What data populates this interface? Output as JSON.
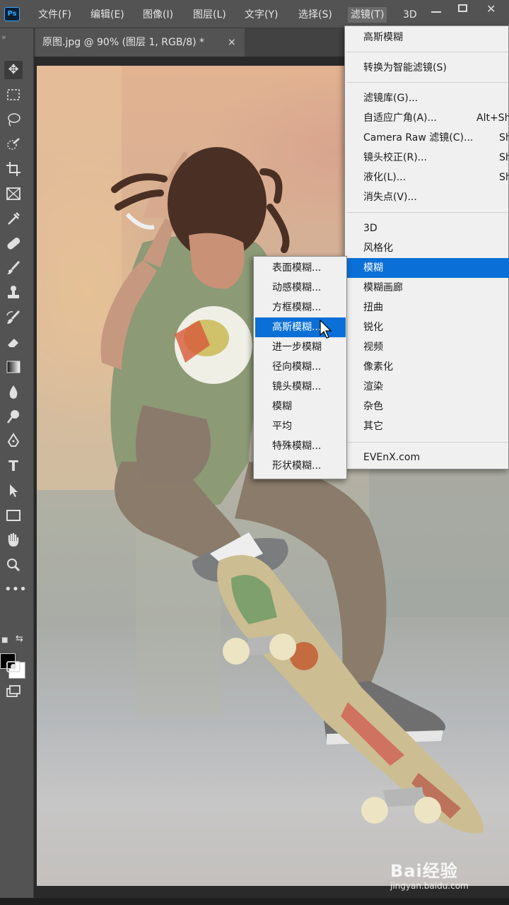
{
  "app": {
    "logo": "Ps"
  },
  "menubar": {
    "items": [
      "文件(F)",
      "编辑(E)",
      "图像(I)",
      "图层(L)",
      "文字(Y)",
      "选择(S)",
      "滤镜(T)",
      "3D"
    ],
    "active": "滤镜(T)"
  },
  "document": {
    "tab_title": "原图.jpg @ 90% (图层 1, RGB/8) *",
    "close_glyph": "×"
  },
  "toolbar": {
    "tools": [
      "move-tool",
      "marquee-tool",
      "lasso-tool",
      "quick-select-tool",
      "crop-tool",
      "frame-tool",
      "eyedropper-tool",
      "healing-brush-tool",
      "brush-tool",
      "clone-stamp-tool",
      "history-brush-tool",
      "eraser-tool",
      "gradient-tool",
      "blur-tool",
      "dodge-tool",
      "pen-tool",
      "type-tool",
      "path-select-tool",
      "rectangle-tool",
      "hand-tool",
      "zoom-tool",
      "more-tools"
    ],
    "foreground_color": "#000000",
    "background_color": "#ffffff"
  },
  "filter_menu": {
    "last_filter": "高斯模糊",
    "convert_smart": "转换为智能滤镜(S)",
    "group1": [
      {
        "label": "滤镜库(G)...",
        "shortcut": ""
      },
      {
        "label": "自适应广角(A)...",
        "shortcut": "Alt+Sh"
      },
      {
        "label": "Camera Raw 滤镜(C)...",
        "shortcut": "Sh"
      },
      {
        "label": "镜头校正(R)...",
        "shortcut": "Sh"
      },
      {
        "label": "液化(L)...",
        "shortcut": "Sh"
      },
      {
        "label": "消失点(V)...",
        "shortcut": ""
      }
    ],
    "group2": [
      "3D",
      "风格化",
      "模糊",
      "模糊画廊",
      "扭曲",
      "锐化",
      "视频",
      "像素化",
      "渲染",
      "杂色",
      "其它"
    ],
    "highlighted": "模糊",
    "plugin": "EVEnX.com"
  },
  "blur_submenu": {
    "items": [
      "表面模糊...",
      "动感模糊...",
      "方框模糊...",
      "高斯模糊...",
      "进一步模糊",
      "径向模糊...",
      "镜头模糊...",
      "模糊",
      "平均",
      "特殊模糊...",
      "形状模糊..."
    ],
    "highlighted": "高斯模糊..."
  },
  "watermark": {
    "text": "Bai经验",
    "url": "jingyan.baidu.com"
  },
  "colors": {
    "highlight": "#0a6fd6",
    "menu_bg": "#f0f0f0",
    "chrome": "#535353"
  }
}
